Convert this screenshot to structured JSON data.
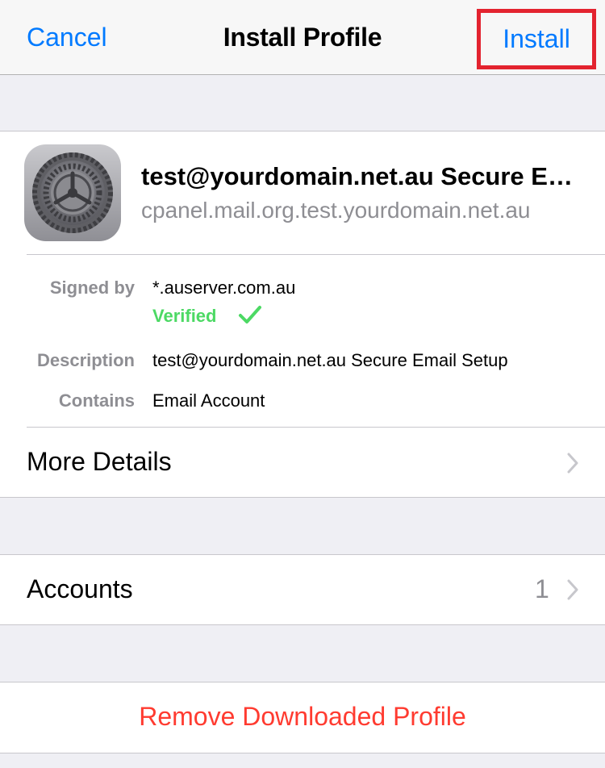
{
  "nav": {
    "cancel_label": "Cancel",
    "title": "Install Profile",
    "install_label": "Install"
  },
  "profile": {
    "icon": "settings-gear-icon",
    "name": "test@yourdomain.net.au Secure Email Setup",
    "host": "cpanel.mail.org.test.yourdomain.net.au",
    "details": {
      "signed_by_label": "Signed by",
      "signed_by_value": "*.auserver.com.au",
      "verified_label": "Verified",
      "description_label": "Description",
      "description_value": "test@yourdomain.net.au Secure Email Setup",
      "contains_label": "Contains",
      "contains_value": "Email Account"
    },
    "more_details_label": "More Details"
  },
  "accounts": {
    "label": "Accounts",
    "count": "1"
  },
  "remove_label": "Remove Downloaded Profile",
  "colors": {
    "accent": "#007aff",
    "verified": "#4cd964",
    "destructive": "#ff3b30",
    "highlight_box": "#e3232f"
  }
}
